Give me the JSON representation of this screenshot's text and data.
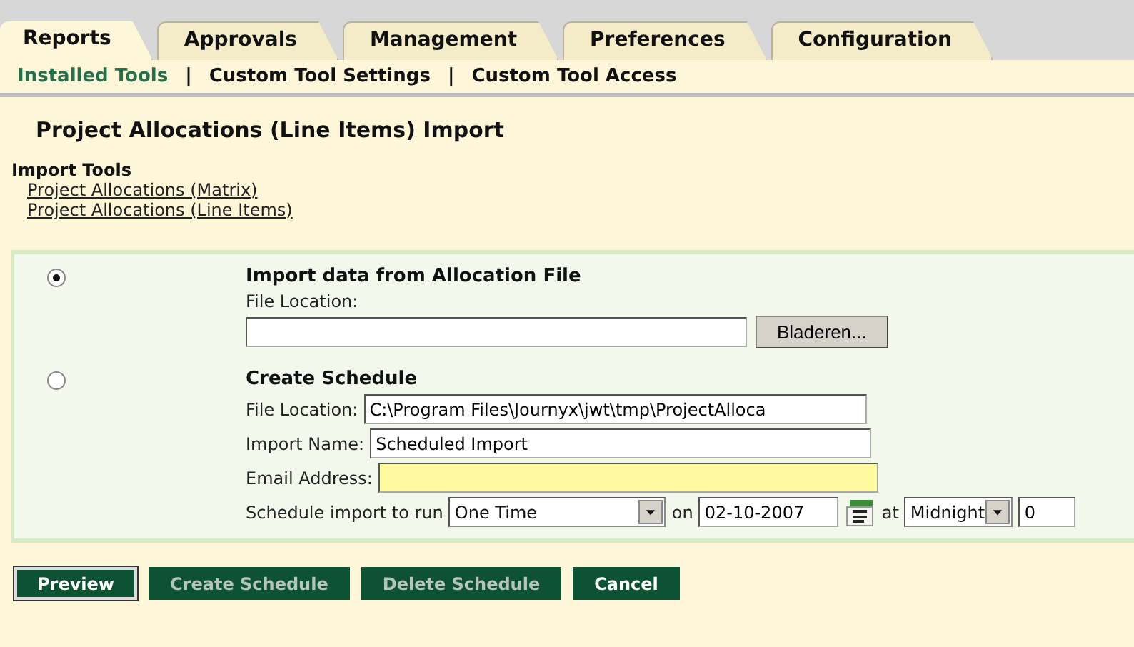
{
  "tabs": [
    {
      "label": "Reports",
      "selected": true
    },
    {
      "label": "Approvals",
      "selected": false
    },
    {
      "label": "Management",
      "selected": false
    },
    {
      "label": "Preferences",
      "selected": false
    },
    {
      "label": "Configuration",
      "selected": false
    }
  ],
  "subnav": [
    {
      "label": "Installed Tools",
      "selected": true
    },
    {
      "label": "Custom Tool Settings",
      "selected": false
    },
    {
      "label": "Custom Tool Access",
      "selected": false
    }
  ],
  "subnav_separator": "|",
  "page_title": "Project Allocations (Line Items) Import",
  "import_tools": {
    "heading": "Import Tools",
    "links": [
      "Project Allocations (Matrix)",
      "Project Allocations (Line Items)"
    ]
  },
  "import_option": {
    "selected": true,
    "heading": "Import data from Allocation File",
    "file_label": "File Location:",
    "browse_button": "Bladeren..."
  },
  "schedule_option": {
    "selected": false,
    "heading": "Create Schedule",
    "file_label": "File Location:",
    "file_value": "C:\\Program Files\\Journyx\\jwt\\tmp\\ProjectAlloca",
    "name_label": "Import Name:",
    "name_value": "Scheduled Import",
    "email_label": "Email Address:",
    "run_label": "Schedule import to run",
    "frequency": "One Time",
    "on_label": "on",
    "date": "02-10-2007",
    "at_label": "at",
    "time": "Midnight",
    "extra_value": "0"
  },
  "buttons": [
    {
      "label": "Preview",
      "disabled": false,
      "focused": true
    },
    {
      "label": "Create Schedule",
      "disabled": true,
      "focused": false
    },
    {
      "label": "Delete Schedule",
      "disabled": true,
      "focused": false
    },
    {
      "label": "Cancel",
      "disabled": false,
      "focused": false
    }
  ]
}
